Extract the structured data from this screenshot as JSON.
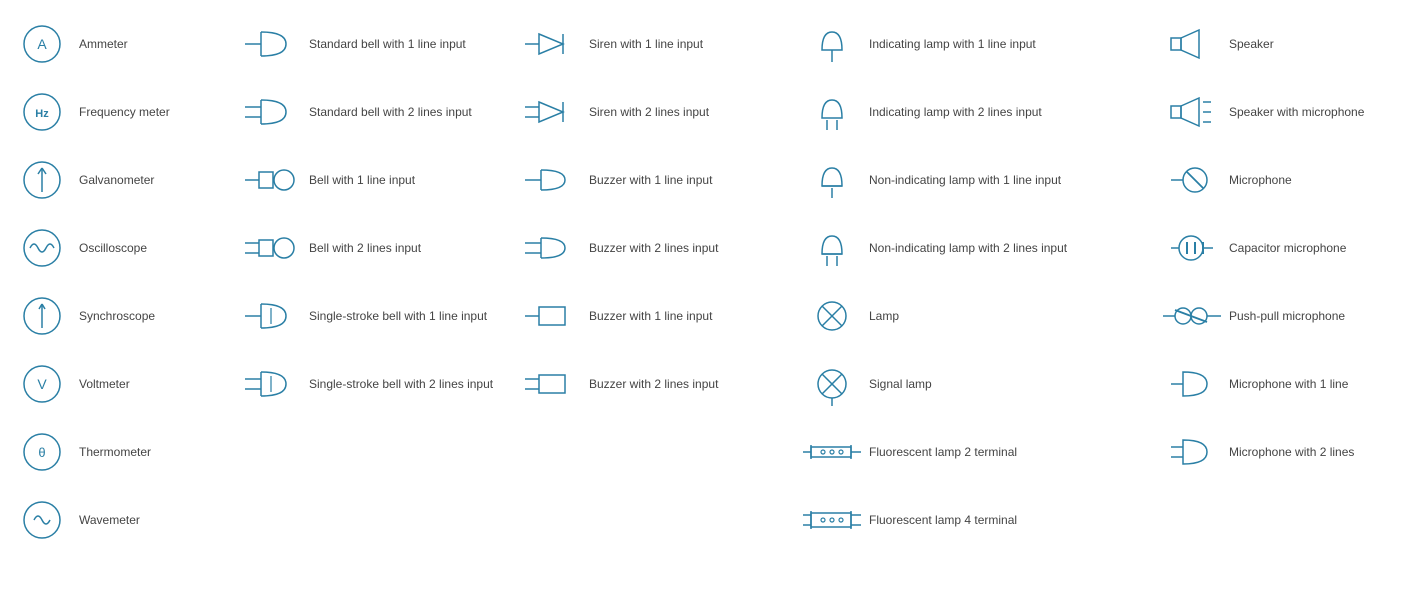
{
  "columns": [
    {
      "id": "col-meters",
      "items": [
        {
          "id": "ammeter",
          "label": "Ammeter",
          "icon": "ammeter"
        },
        {
          "id": "freq-meter",
          "label": "Frequency meter",
          "icon": "freq-meter"
        },
        {
          "id": "galvanometer",
          "label": "Galvanometer",
          "icon": "galvanometer"
        },
        {
          "id": "oscilloscope",
          "label": "Oscilloscope",
          "icon": "oscilloscope"
        },
        {
          "id": "synchroscope",
          "label": "Synchroscope",
          "icon": "synchroscope"
        },
        {
          "id": "voltmeter",
          "label": "Voltmeter",
          "icon": "voltmeter"
        },
        {
          "id": "thermometer",
          "label": "Thermometer",
          "icon": "thermometer"
        },
        {
          "id": "wavemeter",
          "label": "Wavemeter",
          "icon": "wavemeter"
        }
      ]
    },
    {
      "id": "col-bells",
      "items": [
        {
          "id": "std-bell-1",
          "label": "Standard bell with 1 line input",
          "icon": "std-bell-1"
        },
        {
          "id": "std-bell-2",
          "label": "Standard bell with 2 lines input",
          "icon": "std-bell-2"
        },
        {
          "id": "bell-1",
          "label": "Bell with 1 line input",
          "icon": "bell-1"
        },
        {
          "id": "bell-2",
          "label": "Bell with 2 lines input",
          "icon": "bell-2"
        },
        {
          "id": "ss-bell-1",
          "label": "Single-stroke bell with 1 line input",
          "icon": "ss-bell-1"
        },
        {
          "id": "ss-bell-2",
          "label": "Single-stroke bell with 2 lines input",
          "icon": "ss-bell-2"
        }
      ]
    },
    {
      "id": "col-sirens",
      "items": [
        {
          "id": "siren-1",
          "label": "Siren with 1 line input",
          "icon": "siren-1"
        },
        {
          "id": "siren-2",
          "label": "Siren with 2 lines input",
          "icon": "siren-2"
        },
        {
          "id": "buzzer-1line",
          "label": "Buzzer with 1 line input",
          "icon": "buzzer-1line"
        },
        {
          "id": "buzzer-2line",
          "label": "Buzzer with 2 lines input",
          "icon": "buzzer-2line"
        },
        {
          "id": "buzzer-1",
          "label": "Buzzer with 1 line input",
          "icon": "buzzer-sq-1"
        },
        {
          "id": "buzzer-2",
          "label": "Buzzer with 2 lines input",
          "icon": "buzzer-sq-2"
        }
      ]
    },
    {
      "id": "col-lamps",
      "items": [
        {
          "id": "ind-lamp-1",
          "label": "Indicating lamp with 1 line input",
          "icon": "ind-lamp-1"
        },
        {
          "id": "ind-lamp-2",
          "label": "Indicating lamp with 2 lines input",
          "icon": "ind-lamp-2"
        },
        {
          "id": "non-ind-lamp-1",
          "label": "Non-indicating lamp with 1 line input",
          "icon": "non-ind-lamp-1"
        },
        {
          "id": "non-ind-lamp-2",
          "label": "Non-indicating lamp with 2 lines input",
          "icon": "non-ind-lamp-2"
        },
        {
          "id": "lamp",
          "label": "Lamp",
          "icon": "lamp"
        },
        {
          "id": "signal-lamp",
          "label": "Signal lamp",
          "icon": "signal-lamp"
        },
        {
          "id": "fluor-2",
          "label": "Fluorescent lamp 2 terminal",
          "icon": "fluor-2"
        },
        {
          "id": "fluor-4",
          "label": "Fluorescent lamp 4 terminal",
          "icon": "fluor-4"
        }
      ]
    },
    {
      "id": "col-speakers",
      "items": [
        {
          "id": "speaker",
          "label": "Speaker",
          "icon": "speaker"
        },
        {
          "id": "speaker-mic",
          "label": "Speaker with microphone",
          "icon": "speaker-mic"
        },
        {
          "id": "microphone",
          "label": "Microphone",
          "icon": "microphone"
        },
        {
          "id": "cap-mic",
          "label": "Capacitor microphone",
          "icon": "cap-mic"
        },
        {
          "id": "push-pull-mic",
          "label": "Push-pull microphone",
          "icon": "push-pull-mic"
        },
        {
          "id": "mic-1line",
          "label": "Microphone with 1 line",
          "icon": "mic-1line"
        },
        {
          "id": "mic-2lines",
          "label": "Microphone with 2 lines",
          "icon": "mic-2lines"
        }
      ]
    }
  ]
}
